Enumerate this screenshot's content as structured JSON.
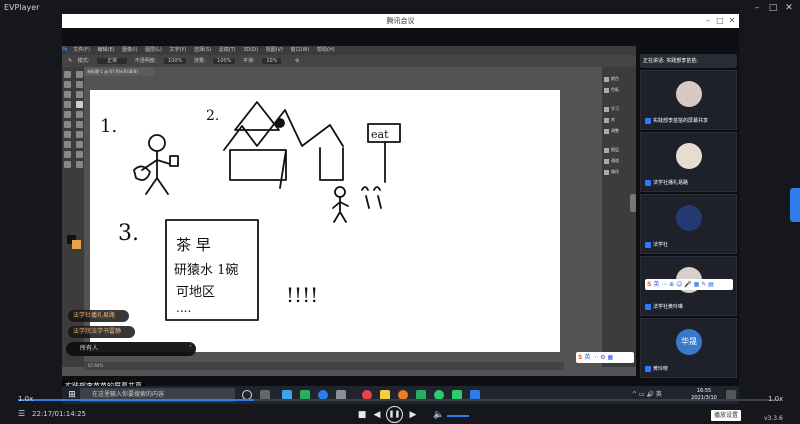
{
  "player": {
    "title": "EVPlayer",
    "rate_left": "1.0x",
    "rate_right": "1.0x",
    "time": "22:17/01:14:25",
    "progress_fraction": 0.31,
    "tooltip": "播放设置",
    "version": "v3.3.6"
  },
  "meeting": {
    "title": "腾讯会议",
    "sharing_label": "实践部李苗苗的屏幕共享",
    "speaking": "正在讲话: 实践部李苗苗;",
    "chat": {
      "bubbles": [
        "法学社播礼易路",
        "法学院法学书雷静"
      ],
      "input_placeholder": "所有人"
    },
    "participants": [
      {
        "name": "实践部李苗苗的屏幕共享"
      },
      {
        "name": "法学社播礼易路"
      },
      {
        "name": "法学社"
      },
      {
        "name": "法学社黄玲琳"
      },
      {
        "name": "黄玲晓",
        "avatar_text": "华晟"
      }
    ],
    "ime_text": "英"
  },
  "photoshop": {
    "menu": [
      "文件(F)",
      "编辑(E)",
      "图像(I)",
      "图层(L)",
      "文字(Y)",
      "选择(S)",
      "滤镜(T)",
      "3D(D)",
      "视图(V)",
      "窗口(W)",
      "帮助(H)"
    ],
    "options": [
      "模式:",
      "正常",
      "不透明度:",
      "100%",
      "流量:",
      "100%",
      "平滑:",
      "10%"
    ],
    "tab": "未标题-1 @ 67.6%(RGB/8)",
    "status": "67.64%",
    "panels": [
      "颜色",
      "色板",
      "学习",
      "库",
      "调整",
      "图层",
      "通道",
      "路径"
    ],
    "drawing_text": {
      "n1": "1.",
      "n2": "2.",
      "n3": "3.",
      "sign": "eat",
      "card_line1": "茶 早",
      "card_line2": "研猿水 1碗",
      "card_line3": "可地区",
      "dots": "....",
      "marks": "!!!!"
    }
  },
  "taskbar": {
    "search_placeholder": "在这里输入你要搜索的内容",
    "time": "16:55",
    "date": "2021/3/10"
  },
  "colors": {
    "accent": "#2f7dea",
    "bg": "#15171c"
  }
}
